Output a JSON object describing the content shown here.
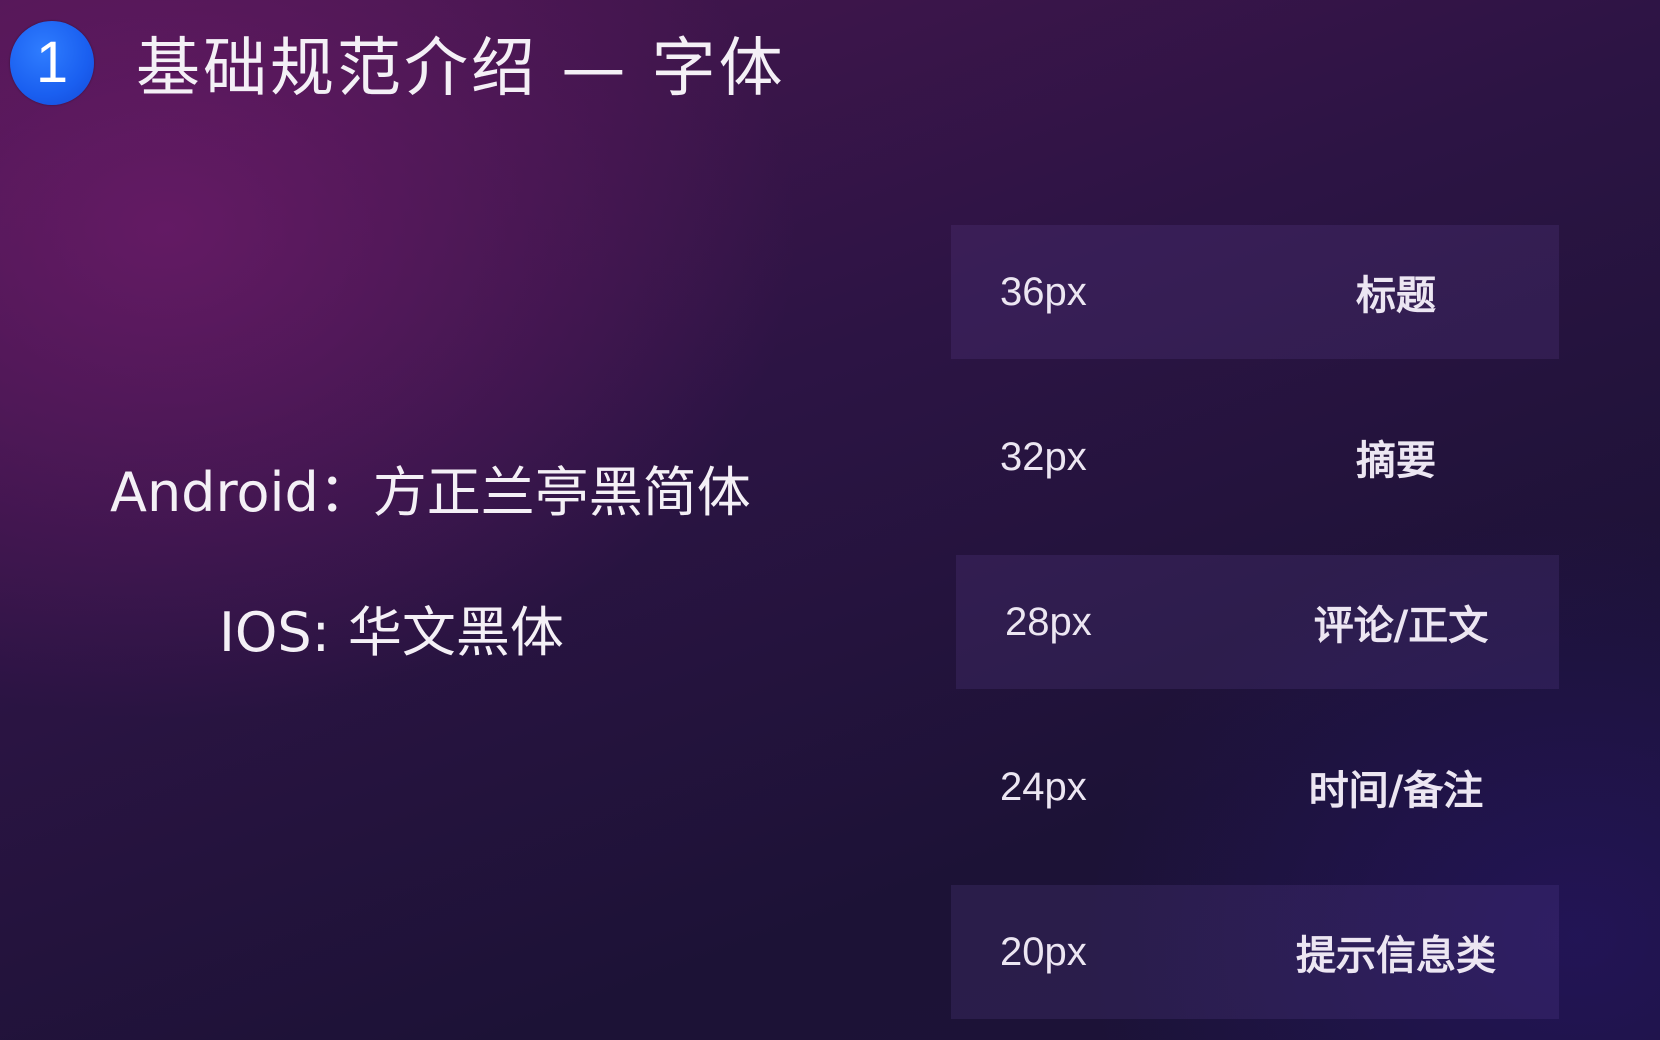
{
  "header": {
    "badge_number": "1",
    "title": "基础规范介绍 — 字体"
  },
  "fonts": {
    "android_label": "Android：",
    "android_font": "方正兰亭黑简体",
    "ios_label": "IOS:",
    "ios_font": "华文黑体"
  },
  "type_scale": [
    {
      "size": "36px",
      "usage": "标题",
      "shaded": true
    },
    {
      "size": "32px",
      "usage": "摘要",
      "shaded": false
    },
    {
      "size": "28px",
      "usage": "评论/正文",
      "shaded": true
    },
    {
      "size": "24px",
      "usage": "时间/备注",
      "shaded": false
    },
    {
      "size": "20px",
      "usage": "提示信息类",
      "shaded": true
    }
  ],
  "colors": {
    "badge": "#1a5ff0",
    "text": "#f4f0f6",
    "background_start": "#4a1650",
    "background_end": "#1b1338"
  }
}
